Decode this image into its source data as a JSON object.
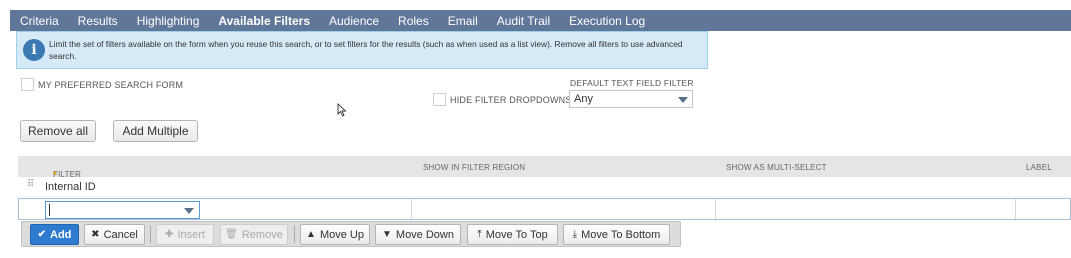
{
  "tabs": [
    {
      "label": "Criteria",
      "active": false
    },
    {
      "label": "Results",
      "active": false
    },
    {
      "label": "Highlighting",
      "active": false
    },
    {
      "label": "Available Filters",
      "active": true
    },
    {
      "label": "Audience",
      "active": false
    },
    {
      "label": "Roles",
      "active": false
    },
    {
      "label": "Email",
      "active": false
    },
    {
      "label": "Audit Trail",
      "active": false
    },
    {
      "label": "Execution Log",
      "active": false
    }
  ],
  "info": {
    "icon": "info-icon",
    "text": "Limit the set of filters available on the form when you reuse this search, or to set filters for the results (such as when used as a list view). Remove all filters to use advanced search."
  },
  "options": {
    "preferred_form_label": "MY PREFERRED SEARCH FORM",
    "preferred_form_checked": false,
    "hide_dropdowns_label": "HIDE FILTER DROPDOWNS",
    "hide_dropdowns_checked": false,
    "default_text_filter_label": "DEFAULT TEXT FIELD FILTER",
    "default_text_filter_value": "Any"
  },
  "buttons": {
    "remove_all": "Remove all",
    "add_multiple": "Add Multiple"
  },
  "grid": {
    "columns": {
      "filter": "FILTER",
      "required_mark": "*",
      "show_in_region": "SHOW IN FILTER REGION",
      "show_multi": "SHOW AS MULTI-SELECT",
      "label": "LABEL"
    },
    "rows": [
      {
        "filter": "Internal ID"
      }
    ],
    "edit_row": {
      "filter_value": ""
    }
  },
  "actions": {
    "add": "Add",
    "cancel": "Cancel",
    "insert": "Insert",
    "remove": "Remove",
    "move_up": "Move Up",
    "move_down": "Move Down",
    "move_top": "Move To Top",
    "move_bottom": "Move To Bottom"
  },
  "colors": {
    "tabbar": "#607799",
    "info_bg": "#d5eaf6",
    "primary": "#2e7bcf",
    "required": "#e3a21a"
  }
}
